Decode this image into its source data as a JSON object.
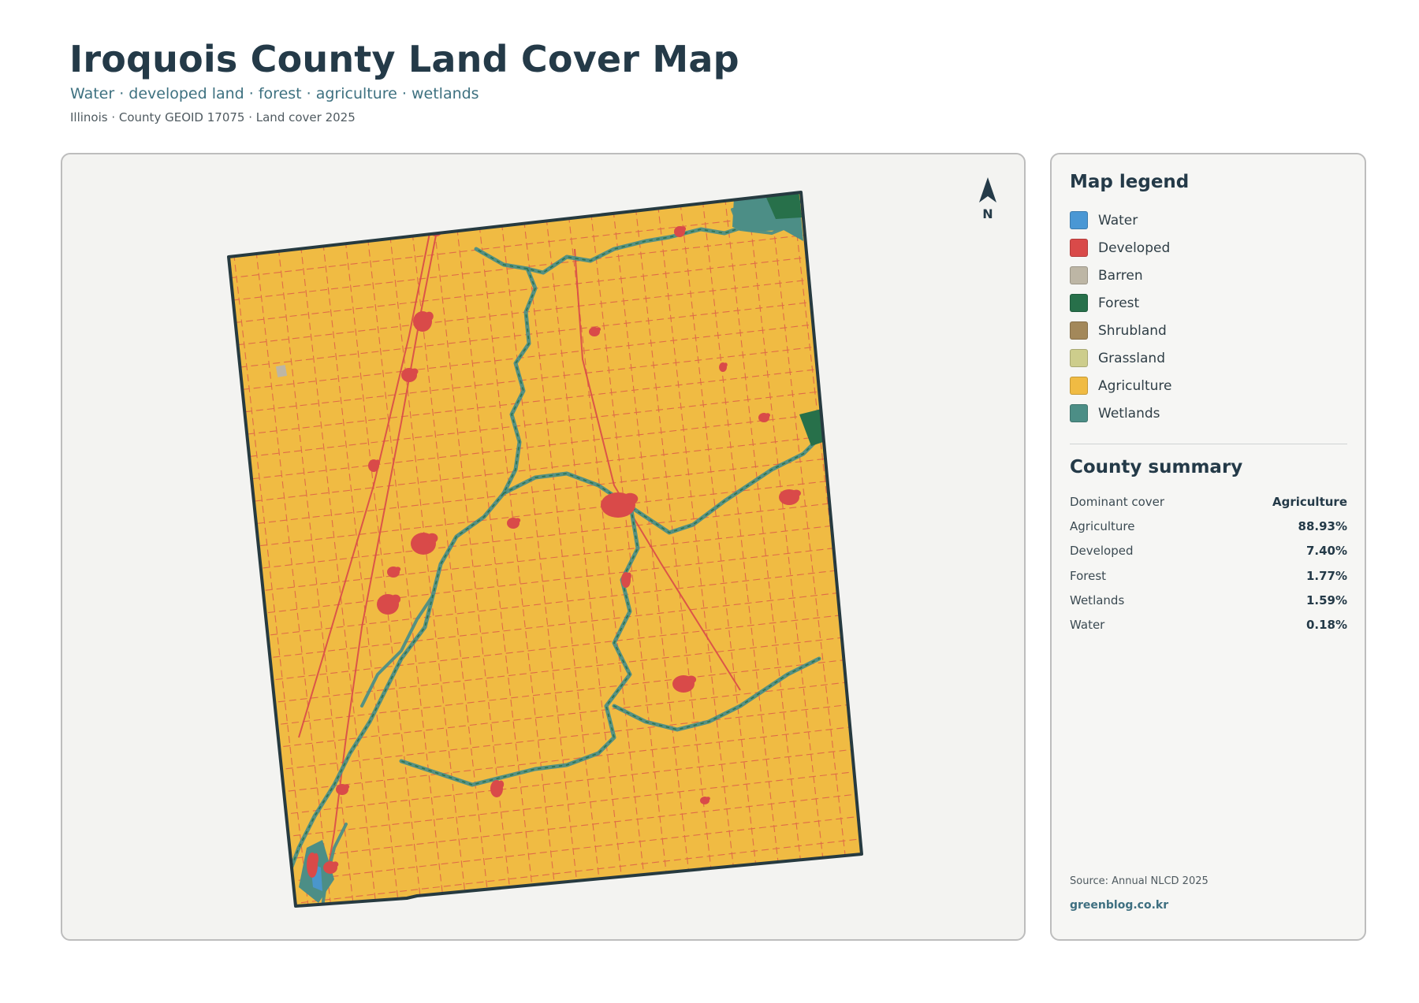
{
  "header": {
    "title": "Iroquois County Land Cover Map",
    "subtitle": "Water · developed land · forest · agriculture · wetlands",
    "meta": "Illinois · County GEOID 17075 · Land cover 2025"
  },
  "map": {
    "north_label": "N",
    "colors": {
      "agriculture": "#f0bb43",
      "developed": "#d94a49",
      "wetlands": "#4c8e86",
      "forest": "#27704a",
      "water": "#4a97d4",
      "barren": "#bdb6a5",
      "border": "#263a40",
      "panel_bg": "#f3f3f1"
    }
  },
  "legend": {
    "title": "Map legend",
    "items": [
      {
        "label": "Water",
        "color": "#4a97d4"
      },
      {
        "label": "Developed",
        "color": "#d94a49"
      },
      {
        "label": "Barren",
        "color": "#bdb6a5"
      },
      {
        "label": "Forest",
        "color": "#27704a"
      },
      {
        "label": "Shrubland",
        "color": "#a3885a"
      },
      {
        "label": "Grassland",
        "color": "#cdcd8c"
      },
      {
        "label": "Agriculture",
        "color": "#f0bb43"
      },
      {
        "label": "Wetlands",
        "color": "#4c8e86"
      }
    ]
  },
  "summary": {
    "title": "County summary",
    "rows": [
      {
        "label": "Dominant cover",
        "value": "Agriculture"
      },
      {
        "label": "Agriculture",
        "value": "88.93%"
      },
      {
        "label": "Developed",
        "value": "7.40%"
      },
      {
        "label": "Forest",
        "value": "1.77%"
      },
      {
        "label": "Wetlands",
        "value": "1.59%"
      },
      {
        "label": "Water",
        "value": "0.18%"
      }
    ]
  },
  "footer": {
    "source": "Source: Annual NLCD 2025",
    "credit": "greenblog.co.kr"
  }
}
